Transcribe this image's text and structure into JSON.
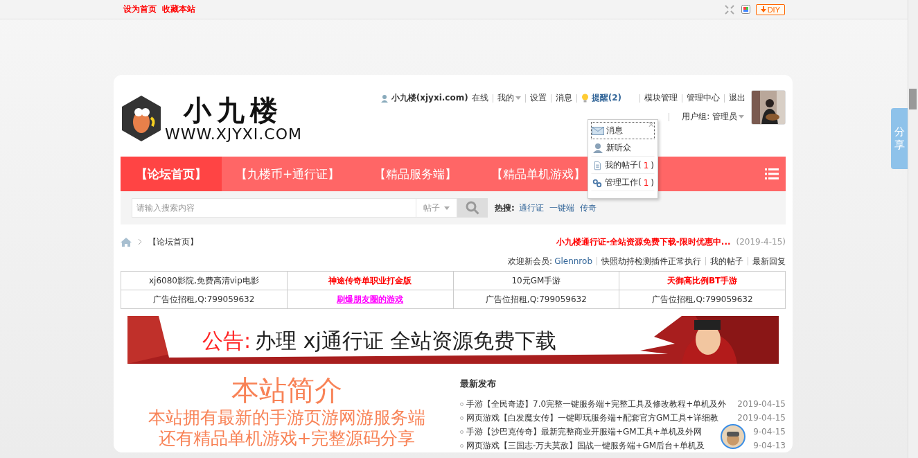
{
  "topbar": {
    "links": [
      "设为首页",
      "收藏本站"
    ],
    "diy": "DIY"
  },
  "side_tab": "分享",
  "logo": {
    "title": "小九楼",
    "url": "WWW.XJYXI.COM"
  },
  "user": {
    "name": "小九楼(xjyxi.com)",
    "status": "在线",
    "links": [
      {
        "label": "我的",
        "dropdown": true
      },
      {
        "label": "设置",
        "dropdown": false
      },
      {
        "label": "消息",
        "dropdown": false
      }
    ],
    "reminder": "提醒(2)",
    "admin_links": [
      "模块管理",
      "管理中心",
      "退出"
    ],
    "group": "用户组: 管理员"
  },
  "popup": {
    "close": "✕",
    "items": [
      {
        "kind": "mail",
        "label": "消息",
        "focused": true
      },
      {
        "kind": "user",
        "label": "新听众",
        "focused": false
      },
      {
        "kind": "doc",
        "label": "我的帖子",
        "count": "(1)",
        "focused": false
      },
      {
        "kind": "link",
        "label": "管理工作",
        "count": "(1)",
        "focused": false
      }
    ]
  },
  "nav": {
    "tabs": [
      {
        "label": "【论坛首页】",
        "selected": true
      },
      {
        "label": "【九楼币+通行证】",
        "selected": false
      },
      {
        "label": "【精品服务端】",
        "selected": false
      },
      {
        "label": "【精品单机游戏】",
        "selected": false
      }
    ]
  },
  "search": {
    "placeholder": "请输入搜索内容",
    "scope": "帖子",
    "hot_label": "热搜:",
    "hot": [
      "通行证",
      "一键端",
      "传奇"
    ]
  },
  "breadcrumb": {
    "current": "【论坛首页】"
  },
  "notice": {
    "text": "小九楼通行证-全站资源免费下载-限时优惠中...",
    "date": "(2019-4-15)"
  },
  "welcome": {
    "label": "欢迎新会员:",
    "member": "Glennrob",
    "links": [
      "快照劫持检测插件正常执行",
      "我的帖子",
      "最新回复"
    ]
  },
  "ads": [
    [
      {
        "text": "xj6080影院,免费高清vip电影",
        "kind": "plain"
      },
      {
        "text": "神途传奇单职业打金版",
        "kind": "hot"
      },
      {
        "text": "10元GM手游",
        "kind": "plain"
      },
      {
        "text": "天御高比例BT手游",
        "kind": "hot"
      }
    ],
    [
      {
        "text": "广告位招租,Q:799059632",
        "kind": "plain"
      },
      {
        "text": "刷爆朋友圈的游戏",
        "kind": "link"
      },
      {
        "text": "广告位招租,Q:799059632",
        "kind": "plain"
      },
      {
        "text": "广告位招租,Q:799059632",
        "kind": "plain"
      }
    ]
  ],
  "banner": {
    "label": "公告:",
    "text": "办理 xj通行证 全站资源免费下载"
  },
  "intro": {
    "title": "本站简介",
    "lines": [
      "本站拥有最新的手游页游网游服务端",
      "还有精品单机游戏+完整源码分享"
    ]
  },
  "latest": {
    "title": "最新发布",
    "items": [
      {
        "title": "手游【全民奇迹】7.0完整一键服务端+完整工具及修改教程+单机及外",
        "date": "2019-04-15"
      },
      {
        "title": "网页游戏【白发魔女传】一键即玩服务端+配套官方GM工具+详细教",
        "date": "2019-04-15"
      },
      {
        "title": "手游【沙巴克传奇】最新完整商业开服端+GM工具+单机及外网",
        "date": "9-04-15"
      },
      {
        "title": "网页游戏【三国志-万夫莫敌】国战一键服务端+GM后台+单机及",
        "date": "9-04-13"
      }
    ]
  }
}
